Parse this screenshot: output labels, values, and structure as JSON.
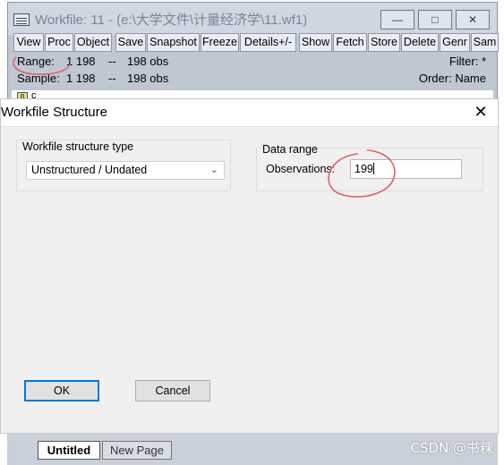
{
  "workfile_window": {
    "title": "Workfile: 11 - (e:\\大学文件\\计量经济学\\11.wf1)",
    "controls": {
      "minimize": "—",
      "maximize": "□",
      "close": "✕"
    },
    "toolbar": [
      "View",
      "Proc",
      "Object",
      "Save",
      "Snapshot",
      "Freeze",
      "Details+/-",
      "Show",
      "Fetch",
      "Store",
      "Delete",
      "Genr",
      "Sam"
    ],
    "range": {
      "label": "Range:",
      "start": "1 198",
      "sep": "--",
      "count": "198 obs"
    },
    "sample": {
      "label": "Sample:",
      "start": "1 198",
      "sep": "--",
      "count": "198 obs"
    },
    "filter": "Filter: *",
    "order": "Order: Name",
    "object_name": "c",
    "object_icon": "β"
  },
  "dialog": {
    "title": "Workfile Structure",
    "close_glyph": "✕",
    "structure_group_label": "Workfile structure type",
    "structure_value": "Unstructured / Undated",
    "data_range_label": "Data range",
    "observations_label": "Observations:",
    "observations_value": "199",
    "ok_label": "OK",
    "cancel_label": "Cancel"
  },
  "tabs": {
    "active": "Untitled",
    "new_page": "New Page"
  },
  "watermark": "CSDN @书粿",
  "colors": {
    "annotation_red": "#e0606a",
    "focus_blue": "#0078d7"
  }
}
